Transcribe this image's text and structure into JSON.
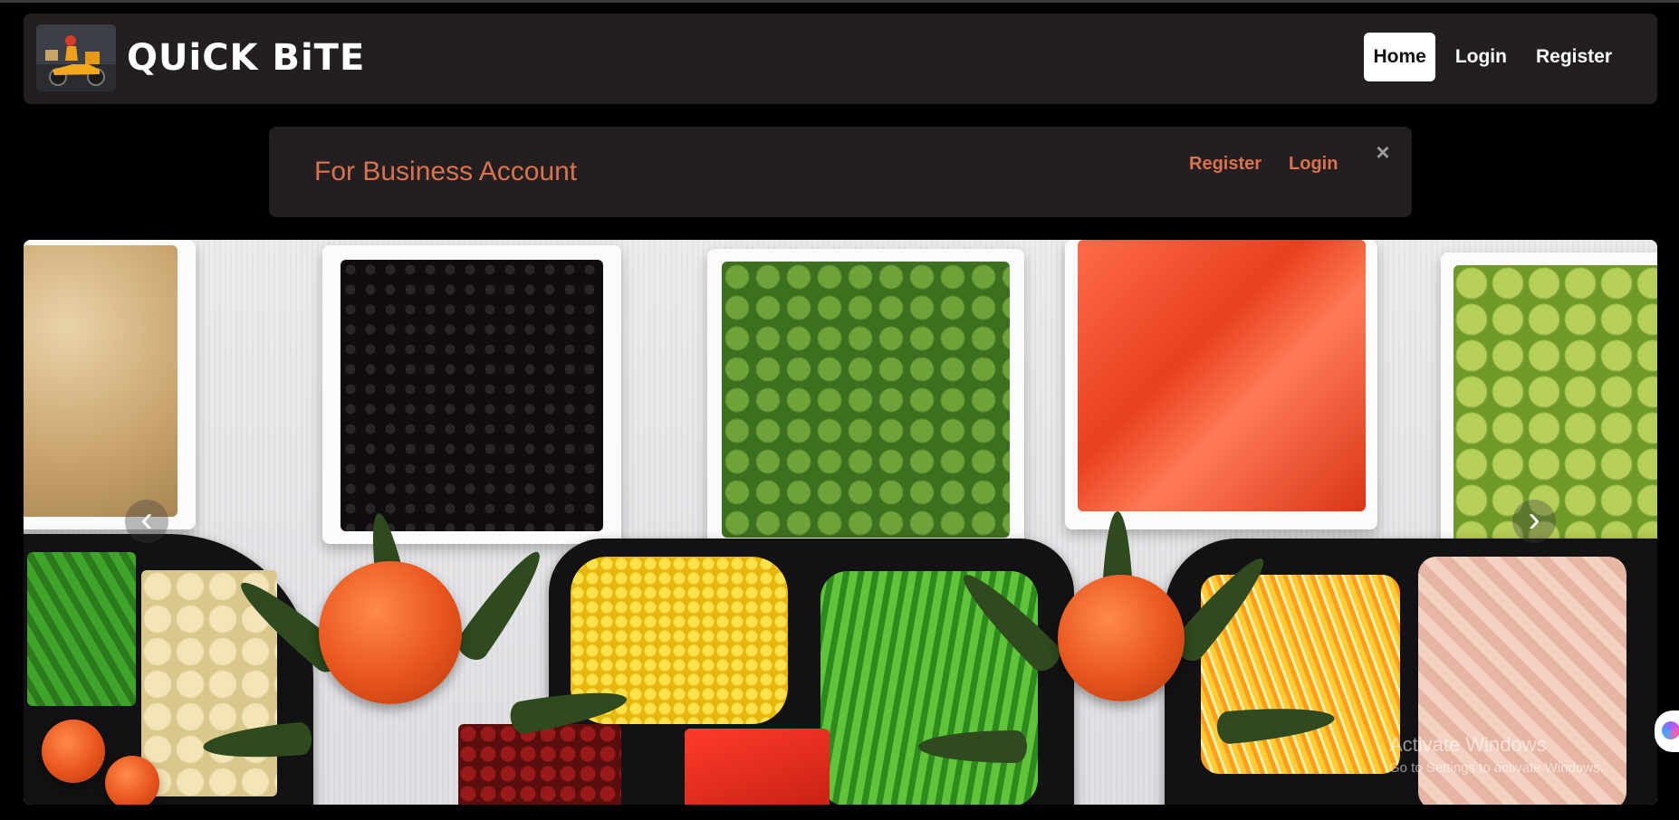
{
  "app": {
    "brand_name": "QUiCK BiTE",
    "logo_icon": "delivery-scooter-logo"
  },
  "nav": {
    "items": [
      {
        "label": "Home",
        "active": true
      },
      {
        "label": "Login",
        "active": false
      },
      {
        "label": "Register",
        "active": false
      }
    ]
  },
  "business_banner": {
    "title": "For Business Account",
    "register_label": "Register",
    "login_label": "Login",
    "close_symbol": "×"
  },
  "carousel": {
    "prev_icon": "chevron-left-icon",
    "next_icon": "chevron-right-icon",
    "prev_symbol": "‹",
    "next_symbol": "›"
  },
  "watermark": {
    "line1": "Activate Windows",
    "line2": "Go to Settings to activate Windows."
  },
  "colors": {
    "page_bg": "#000000",
    "panel_bg": "#231f20",
    "accent": "#d9734f",
    "active_nav_bg": "#ffffff"
  }
}
